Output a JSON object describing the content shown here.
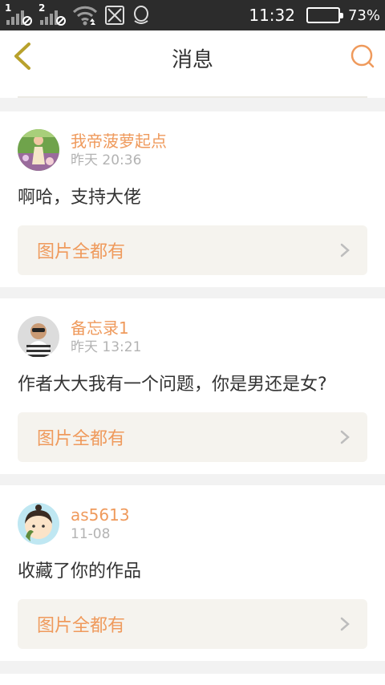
{
  "status_bar": {
    "time": "11:32",
    "battery_percent_text": "73%",
    "battery_level": 0.73,
    "sim1_label": "1",
    "sim2_label": "2",
    "icons": [
      "signal-icon-sim1",
      "signal-icon-sim2",
      "wifi-icon",
      "notification-off-icon",
      "qq-icon"
    ]
  },
  "header": {
    "title": "消息",
    "back_icon": "chevron-left-icon",
    "search_icon": "search-icon",
    "accent_color": "#ef9a5c",
    "back_color": "#b8a12c"
  },
  "messages": [
    {
      "username": "我帝菠萝起点",
      "time": "昨天 20:36",
      "text": "啊哈，支持大佬",
      "work_title": "图片全都有"
    },
    {
      "username": "备忘录1",
      "time": "昨天 13:21",
      "text": "作者大大我有一个问题，你是男还是女?",
      "work_title": "图片全都有"
    },
    {
      "username": "as5613",
      "time": "11-08",
      "text": "收藏了你的作品",
      "work_title": "图片全都有"
    }
  ]
}
